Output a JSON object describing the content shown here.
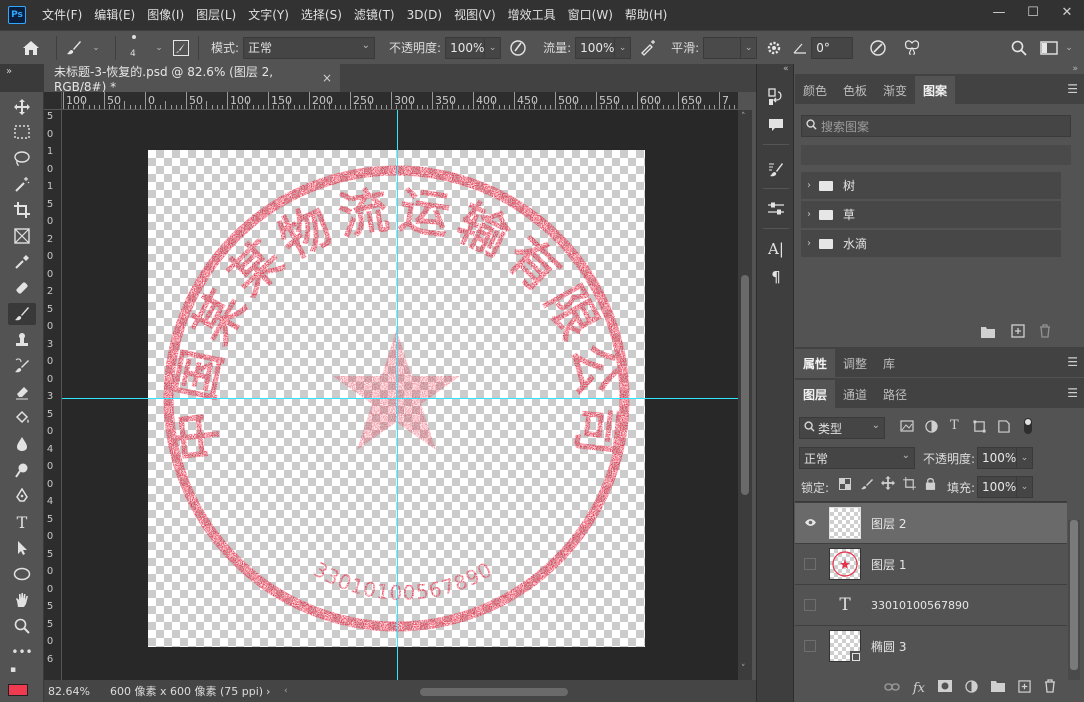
{
  "app": {
    "logo": "Ps"
  },
  "menu": [
    "文件(F)",
    "编辑(E)",
    "图像(I)",
    "图层(L)",
    "文字(Y)",
    "选择(S)",
    "滤镜(T)",
    "3D(D)",
    "视图(V)",
    "增效工具",
    "窗口(W)",
    "帮助(H)"
  ],
  "options": {
    "brush_size": "4",
    "mode_label": "模式:",
    "mode_value": "正常",
    "opacity_label": "不透明度:",
    "opacity_value": "100%",
    "flow_label": "流量:",
    "flow_value": "100%",
    "smooth_label": "平滑:",
    "angle_value": "0°"
  },
  "document_tab": {
    "title": "未标题-3-恢复的.psd @ 82.6% (图层 2, RGB/8#) *",
    "close": "×"
  },
  "rulers": {
    "top_labels": [
      "100",
      "50",
      "0",
      "50",
      "100",
      "150",
      "200",
      "250",
      "300",
      "350",
      "400",
      "450",
      "500",
      "550",
      "600",
      "650",
      "7"
    ],
    "left_labels": [
      "5",
      "0",
      "1",
      "0",
      "1",
      "5",
      "0",
      "2",
      "0",
      "0",
      "2",
      "5",
      "0",
      "3",
      "0",
      "0",
      "3",
      "5",
      "0",
      "4",
      "0",
      "0",
      "4",
      "5",
      "0",
      "5",
      "0",
      "0",
      "5",
      "5",
      "0",
      "6"
    ]
  },
  "stamp": {
    "arc_text": "中国某某物流运输有限公司",
    "number_text": "33010100567890",
    "color": "#e8324b"
  },
  "status": {
    "zoom": "82.64%",
    "doc_size": "600 像素 x 600 像素 (75 ppi)",
    "arrow": "›"
  },
  "pattern_panel": {
    "tabs": [
      "颜色",
      "色板",
      "渐变",
      "图案"
    ],
    "active_tab": "图案",
    "search_placeholder": "搜索图案",
    "folders": [
      "树",
      "草",
      "水滴"
    ]
  },
  "props_panel": {
    "tabs": [
      "属性",
      "调整",
      "库"
    ],
    "active_tab": "属性"
  },
  "layers_panel": {
    "tabs": [
      "图层",
      "通道",
      "路径"
    ],
    "active_tab": "图层",
    "filter_value": "类型",
    "blend_value": "正常",
    "opacity_label": "不透明度:",
    "opacity_value": "100%",
    "lock_label": "锁定:",
    "fill_label": "填充:",
    "fill_value": "100%",
    "layers": [
      {
        "name": "图层 2",
        "visible": true,
        "selected": true,
        "kind": "pixel"
      },
      {
        "name": "图层 1",
        "visible": false,
        "selected": false,
        "kind": "pixel-star"
      },
      {
        "name": "33010100567890",
        "visible": false,
        "selected": false,
        "kind": "text"
      },
      {
        "name": "椭圆 3",
        "visible": false,
        "selected": false,
        "kind": "shape"
      }
    ]
  },
  "colors": {
    "accent_guide": "#2ee6ff",
    "foreground": "#f03a4f"
  }
}
